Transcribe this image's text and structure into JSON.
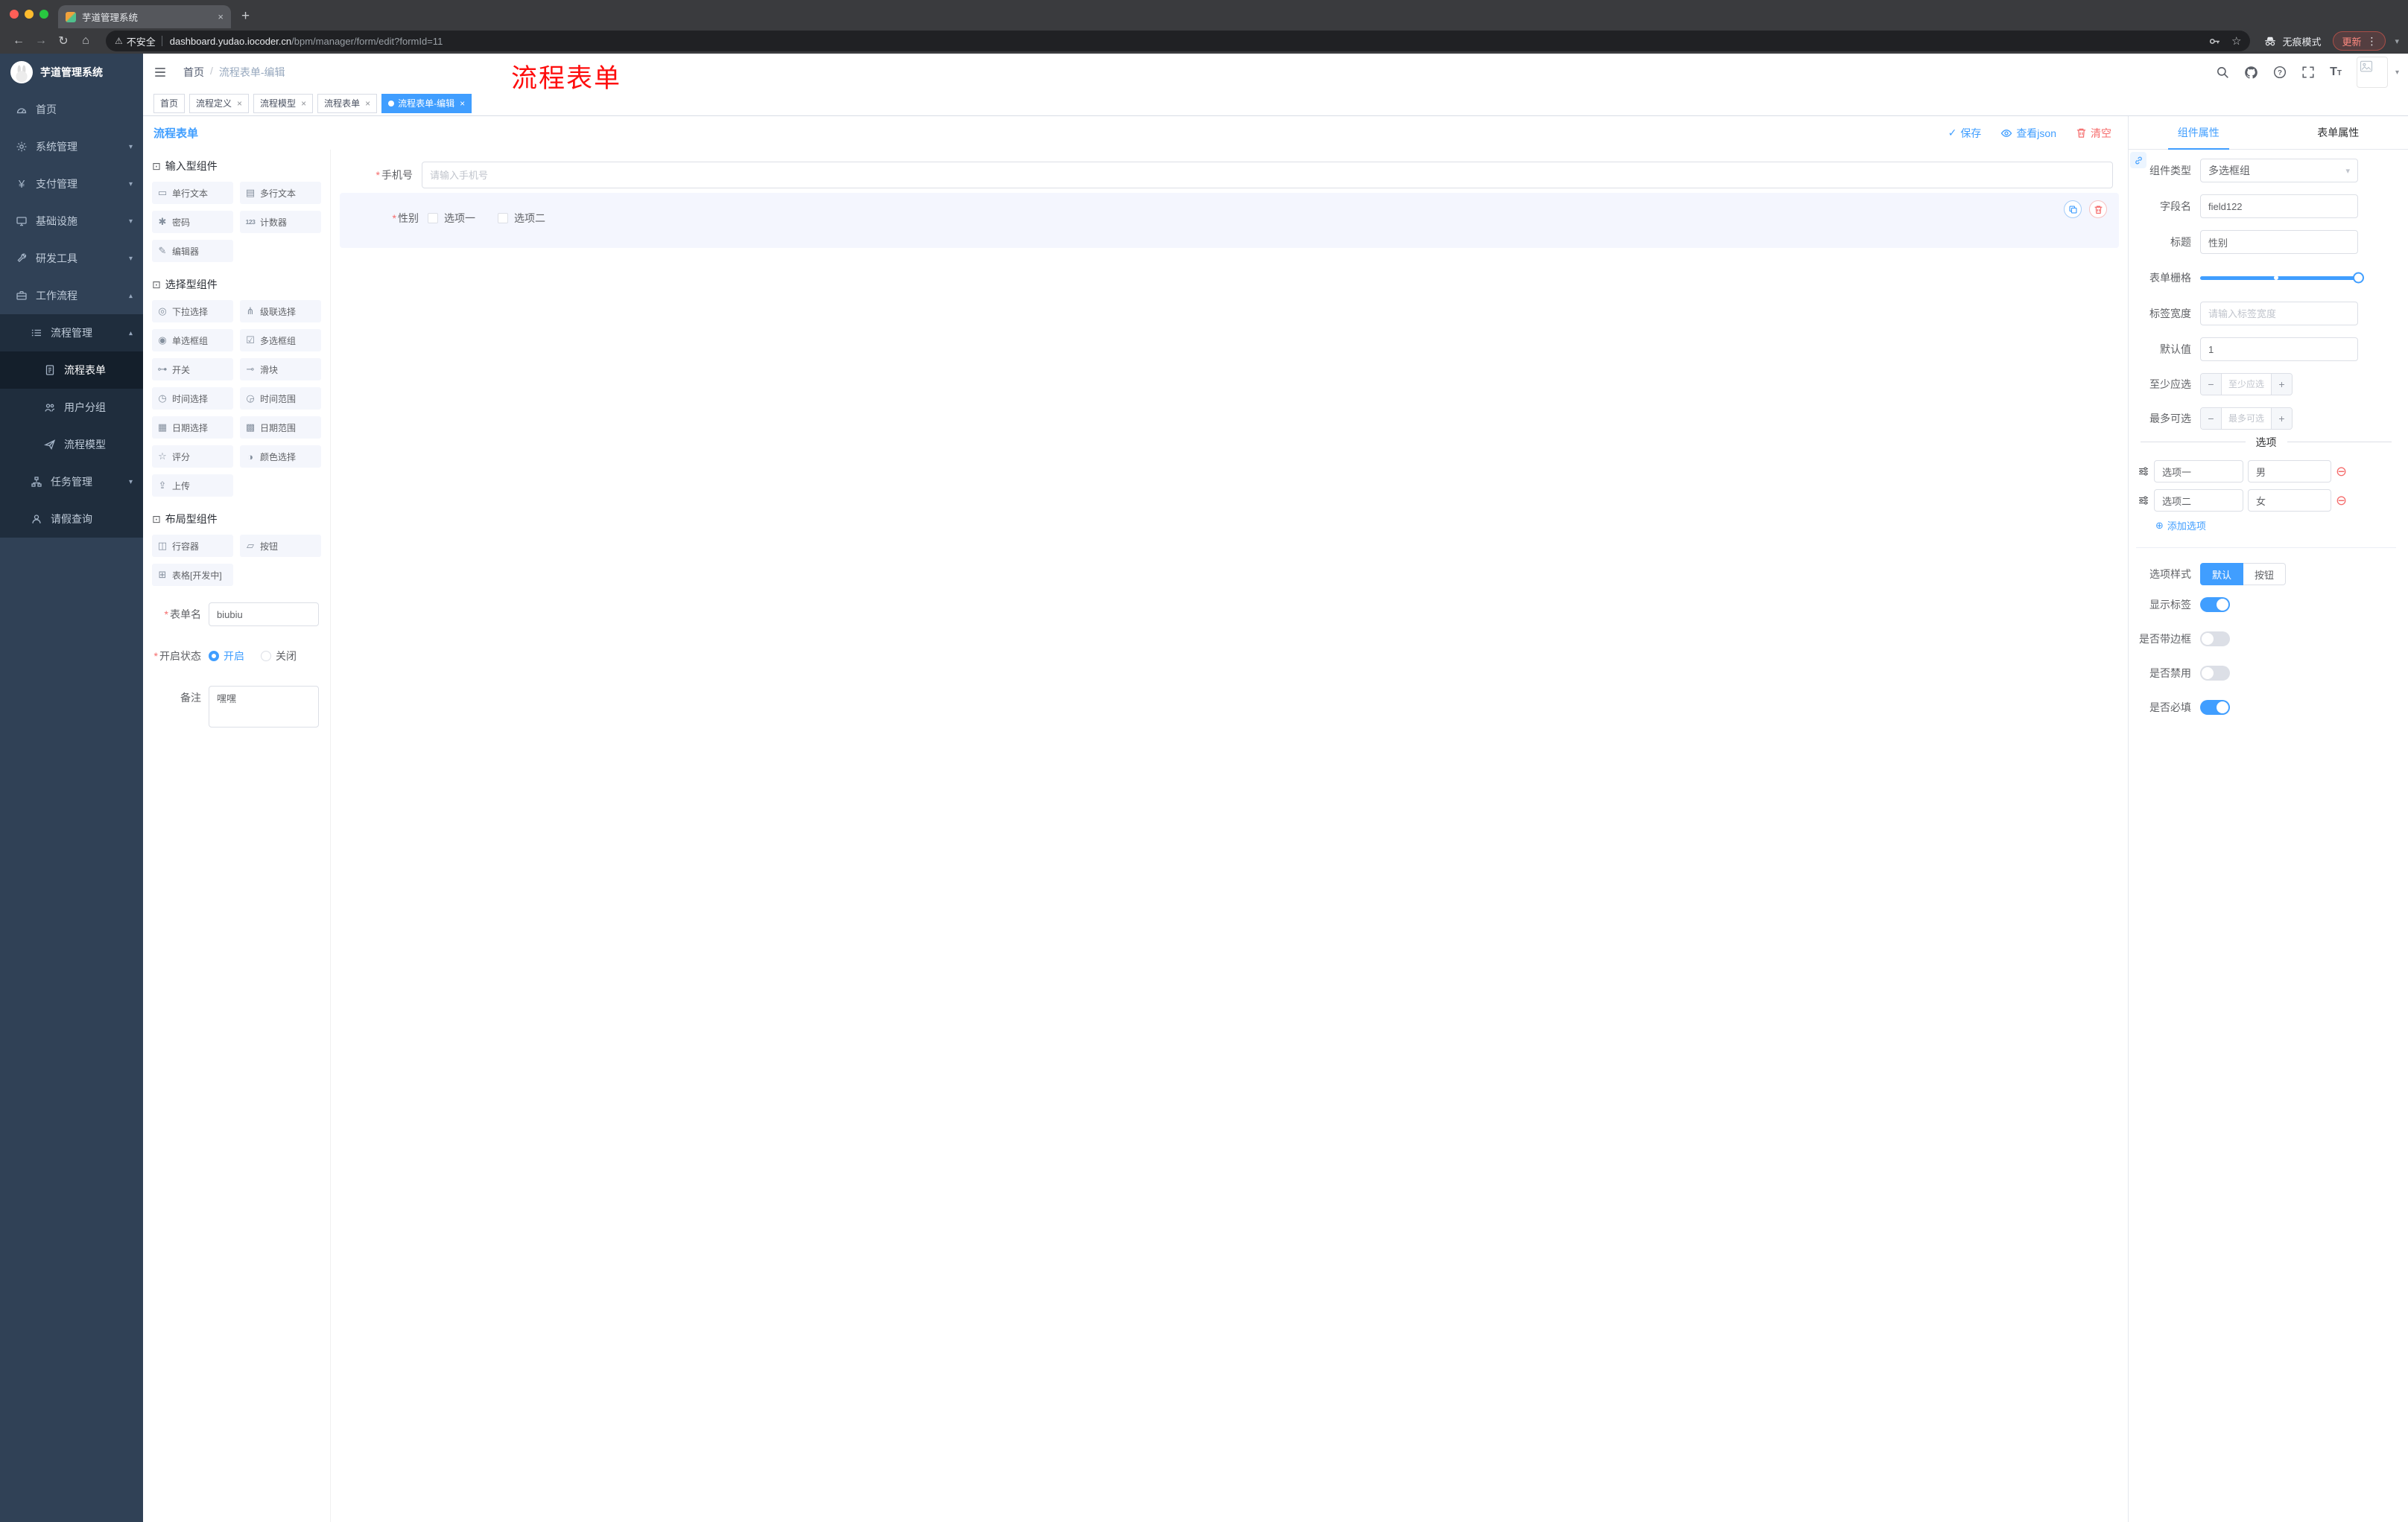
{
  "ui": {
    "close": "×",
    "plus": "+",
    "minus": "−",
    "caret": "▾",
    "back": "←",
    "forward": "→",
    "reload": "↻",
    "home": "⌂",
    "star": "☆",
    "warning": "⚠",
    "kebab": "⋮",
    "check": "✓",
    "add_circle": "⊕",
    "remove_circle": "⊖",
    "asterisk": "*"
  },
  "colors": {
    "accent": "#409eff",
    "danger": "#f56c6c",
    "annotation": "#fe0d0d",
    "sidebar_bg": "#304156",
    "submenu_bg": "#1f2d3d",
    "mac_close": "#ff5f57",
    "mac_minimize": "#febc2e",
    "mac_zoom": "#28c840"
  },
  "browser": {
    "tab": {
      "title": "芋道管理系统"
    },
    "address": {
      "security_label": "不安全",
      "domain": "dashboard.yudao.iocoder.cn",
      "path": "/bpm/manager/form/edit?formId=11"
    },
    "incognito_label": "无痕模式",
    "update_button": "更新"
  },
  "sidebar": {
    "logo_title": "芋道管理系统",
    "items": [
      {
        "label": "首页"
      },
      {
        "label": "系统管理"
      },
      {
        "label": "支付管理"
      },
      {
        "label": "基础设施"
      },
      {
        "label": "研发工具"
      },
      {
        "label": "工作流程"
      },
      {
        "label": "流程管理"
      },
      {
        "label": "流程表单"
      },
      {
        "label": "用户分组"
      },
      {
        "label": "流程模型"
      },
      {
        "label": "任务管理"
      },
      {
        "label": "请假查询"
      }
    ]
  },
  "header": {
    "breadcrumb": [
      "首页",
      "流程表单-编辑"
    ],
    "separator": "/",
    "annotation": "流程表单"
  },
  "tags": {
    "items": [
      {
        "label": "首页"
      },
      {
        "label": "流程定义"
      },
      {
        "label": "流程模型"
      },
      {
        "label": "流程表单"
      },
      {
        "label": "流程表单-编辑"
      }
    ]
  },
  "designer": {
    "title": "流程表单",
    "actions": {
      "save": "保存",
      "view_json": "查看json",
      "clear": "清空"
    },
    "palette": {
      "groups": [
        {
          "title": "输入型组件",
          "icon": "⊡",
          "items": [
            {
              "label": "单行文本",
              "icon": "▭"
            },
            {
              "label": "多行文本",
              "icon": "▤"
            },
            {
              "label": "密码",
              "icon": "✱"
            },
            {
              "label": "计数器",
              "icon": "123"
            },
            {
              "label": "编辑器",
              "icon": "✎"
            }
          ]
        },
        {
          "title": "选择型组件",
          "icon": "⊡",
          "items": [
            {
              "label": "下拉选择",
              "icon": "◎"
            },
            {
              "label": "级联选择",
              "icon": "⋔"
            },
            {
              "label": "单选框组",
              "icon": "◉"
            },
            {
              "label": "多选框组",
              "icon": "☑"
            },
            {
              "label": "开关",
              "icon": "⊶"
            },
            {
              "label": "滑块",
              "icon": "⊸"
            },
            {
              "label": "时间选择",
              "icon": "◷"
            },
            {
              "label": "时间范围",
              "icon": "◶"
            },
            {
              "label": "日期选择",
              "icon": "▦"
            },
            {
              "label": "日期范围",
              "icon": "▩"
            },
            {
              "label": "评分",
              "icon": "☆"
            },
            {
              "label": "颜色选择",
              "icon": "◑"
            },
            {
              "label": "上传",
              "icon": "⇪"
            }
          ]
        },
        {
          "title": "布局型组件",
          "icon": "⊡",
          "items": [
            {
              "label": "行容器",
              "icon": "◫"
            },
            {
              "label": "按钮",
              "icon": "▱"
            },
            {
              "label": "表格[开发中]",
              "icon": "⊞"
            }
          ]
        }
      ]
    },
    "meta_form": {
      "form_name_label": "表单名",
      "form_name_value": "biubiu",
      "status_label": "开启状态",
      "status_on": "开启",
      "status_off": "关闭",
      "remark_label": "备注",
      "remark_value": "嘿嘿"
    },
    "canvas": {
      "phone": {
        "label": "手机号",
        "placeholder": "请输入手机号"
      },
      "gender": {
        "label": "性别",
        "options": [
          "选项一",
          "选项二"
        ]
      }
    }
  },
  "inspector": {
    "tab_component": "组件属性",
    "tab_form": "表单属性",
    "component_type": {
      "label": "组件类型",
      "value": "多选框组"
    },
    "field_name": {
      "label": "字段名",
      "value": "field122"
    },
    "title": {
      "label": "标题",
      "value": "性别"
    },
    "grid": {
      "label": "表单栅格"
    },
    "label_width": {
      "label": "标签宽度",
      "placeholder": "请输入标签宽度"
    },
    "default_value": {
      "label": "默认值",
      "value": "1"
    },
    "min_select": {
      "label": "至少应选",
      "placeholder": "至少应选"
    },
    "max_select": {
      "label": "最多可选",
      "placeholder": "最多可选"
    },
    "options_divider": "选项",
    "options": [
      {
        "value": "选项一",
        "extra": "男"
      },
      {
        "value": "选项二",
        "extra": "女"
      }
    ],
    "add_option": "添加选项",
    "option_style": {
      "label": "选项样式",
      "default": "默认",
      "button": "按钮"
    },
    "switches": [
      {
        "label": "显示标签",
        "on": true
      },
      {
        "label": "是否带边框",
        "on": false
      },
      {
        "label": "是否禁用",
        "on": false
      },
      {
        "label": "是否必填",
        "on": true
      }
    ]
  }
}
